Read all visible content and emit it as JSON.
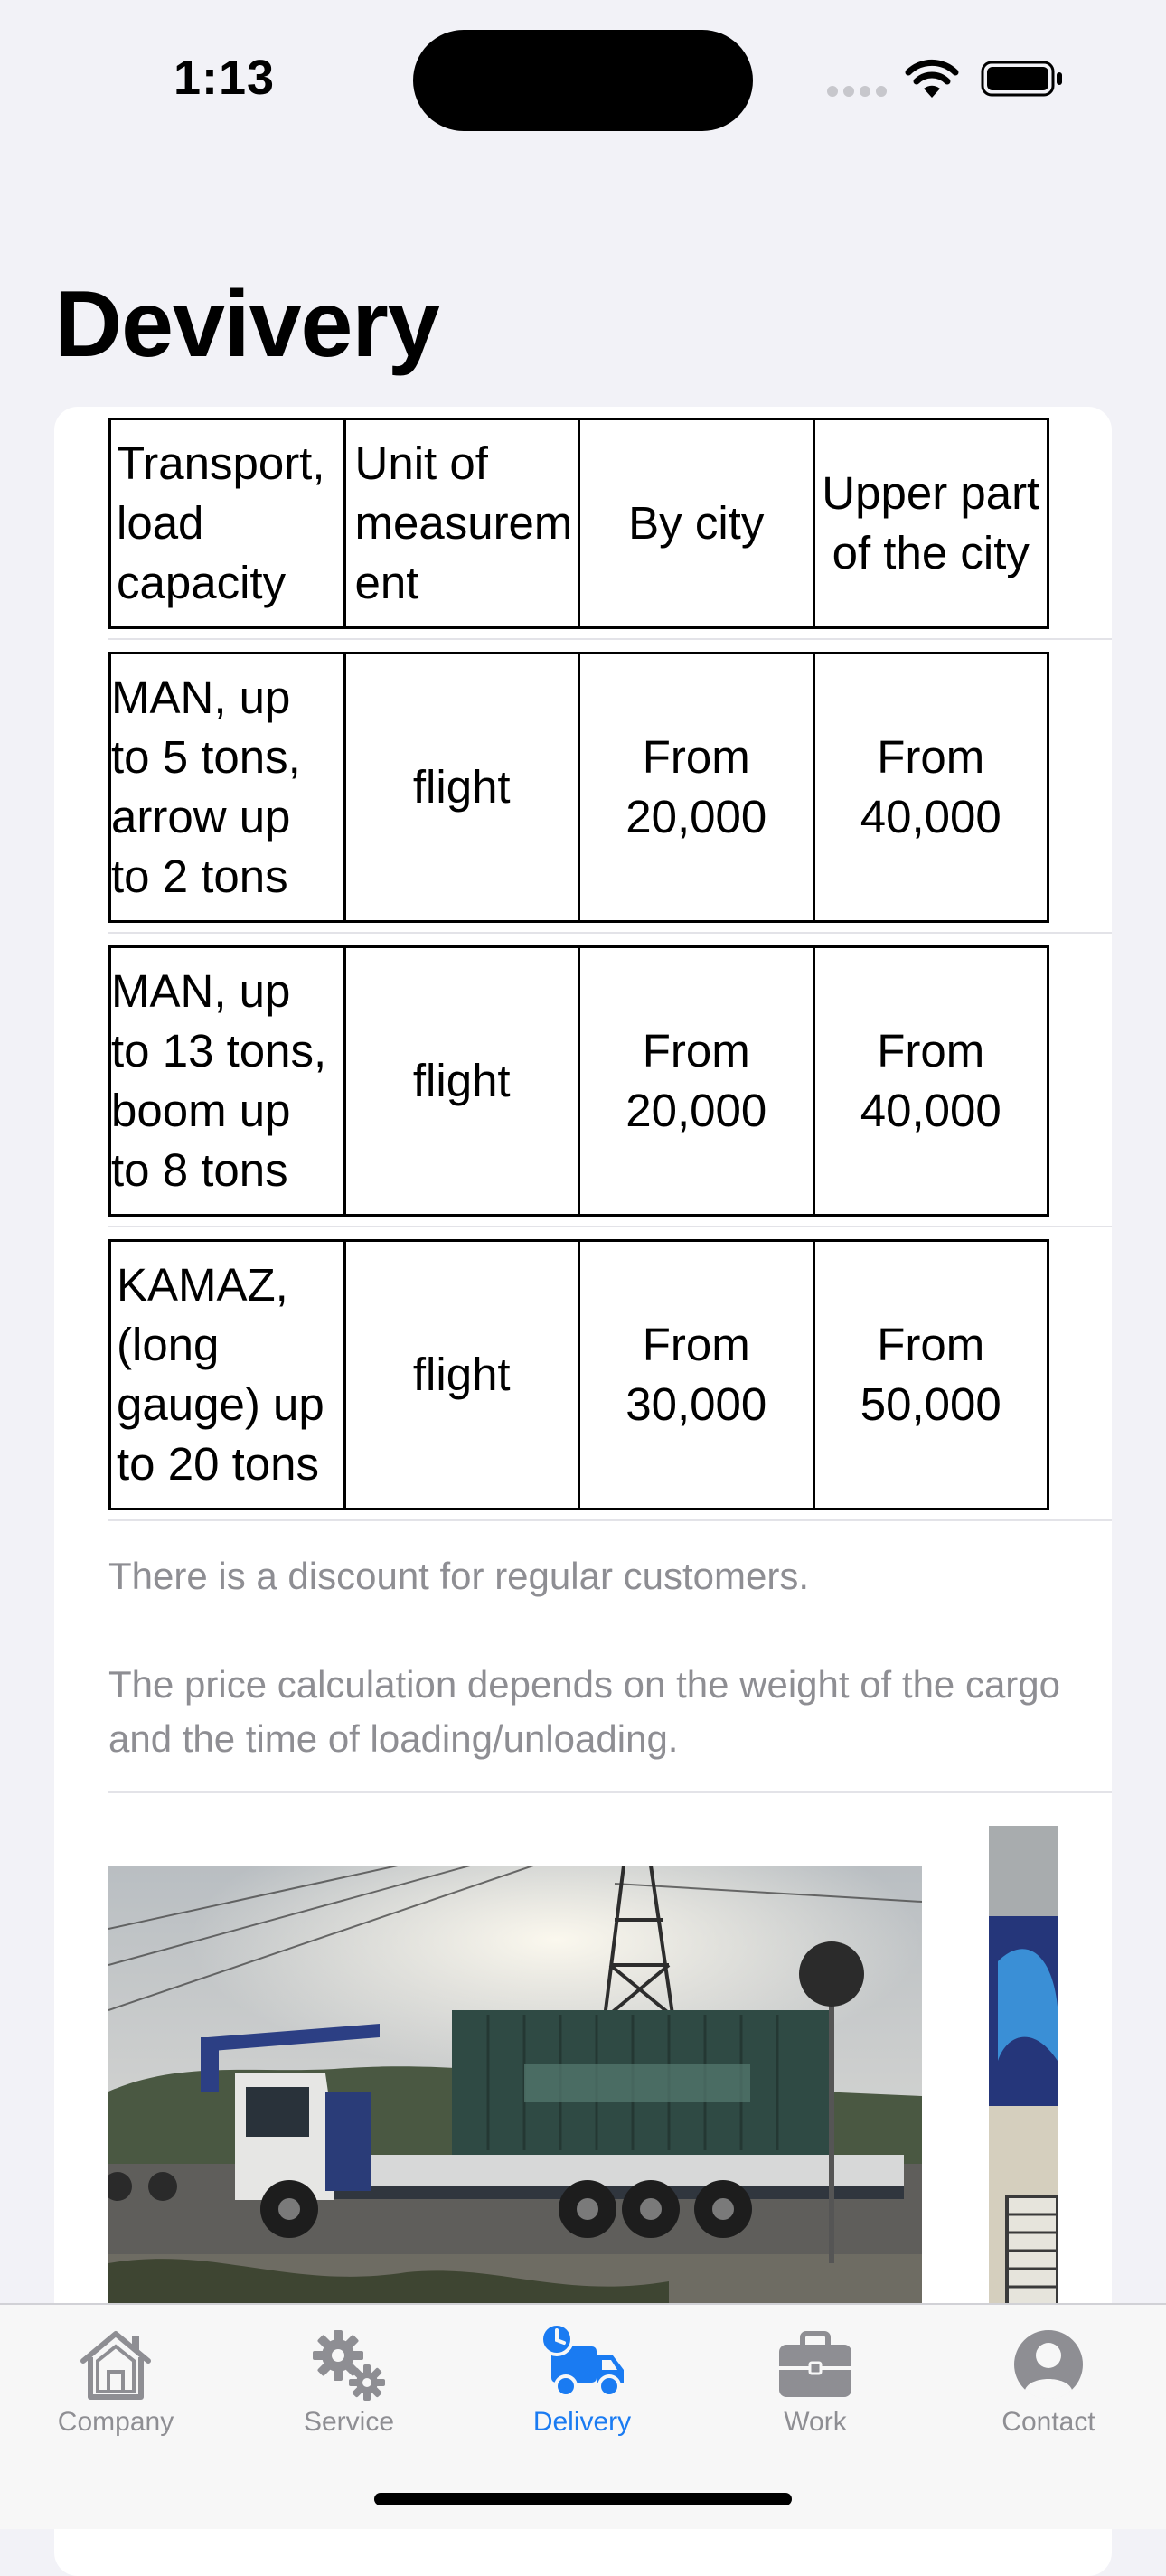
{
  "status": {
    "time": "1:13"
  },
  "page": {
    "title": "Devivery"
  },
  "table": {
    "headers": [
      "Transport, load capacity",
      "Unit of measurem ent",
      "By city",
      "Upper part of the city"
    ],
    "rows": [
      [
        "MAN, up to 5 tons, arrow up to 2 tons",
        "flight",
        "From 20,000",
        "From 40,000"
      ],
      [
        "MAN, up to 13 tons, boom up to 8 tons",
        "flight",
        "From 20,000",
        "From 40,000"
      ],
      [
        "KAMAZ, (long gauge) up to 20 tons",
        "flight",
        "From 30,000",
        "From 50,000"
      ]
    ]
  },
  "notes": {
    "discount": "There is a discount for regular customers.",
    "price": "The price calculation depends on the weight of the cargo and the time of loading/unloading."
  },
  "tabs": [
    {
      "label": "Company",
      "icon": "house-icon",
      "active": false
    },
    {
      "label": "Service",
      "icon": "gears-icon",
      "active": false
    },
    {
      "label": "Delivery",
      "icon": "truck-clock-icon",
      "active": true
    },
    {
      "label": "Work",
      "icon": "briefcase-icon",
      "active": false
    },
    {
      "label": "Contact",
      "icon": "person-circle-icon",
      "active": false
    }
  ],
  "colors": {
    "accent": "#1a7bf2",
    "inactive": "#8e8e93",
    "background": "#f2f2f7"
  }
}
